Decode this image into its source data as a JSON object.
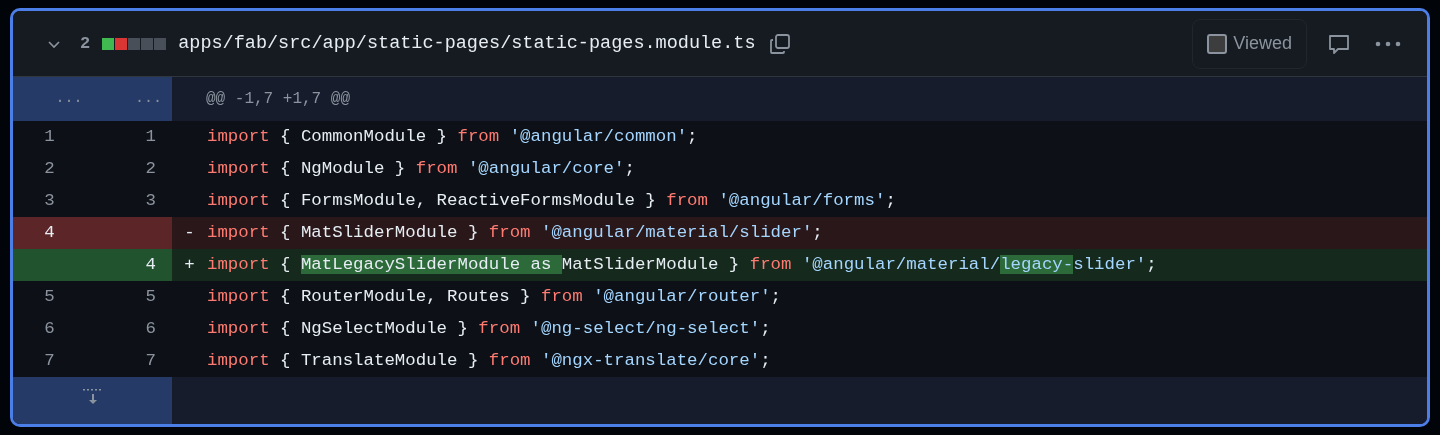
{
  "file": {
    "expanded": true,
    "change_count": "2",
    "stat_blocks": [
      {
        "color": "#3fb950"
      },
      {
        "color": "#da3633"
      },
      {
        "color": "#484f58"
      },
      {
        "color": "#484f58"
      },
      {
        "color": "#484f58"
      }
    ],
    "path": "apps/fab/src/app/static-pages/static-pages.module.ts",
    "viewed": {
      "label": "Viewed",
      "checked": false
    }
  },
  "hunk": {
    "left": "...",
    "right": "...",
    "header": "@@ -1,7 +1,7 @@"
  },
  "lines": [
    {
      "kind": "context",
      "old": "1",
      "new": "1",
      "segments": [
        {
          "kind": "keyword",
          "text": "import"
        },
        {
          "kind": "plain",
          "text": " { CommonModule } "
        },
        {
          "kind": "keyword",
          "text": "from"
        },
        {
          "kind": "string",
          "text": " '@angular/common'"
        },
        {
          "kind": "plain",
          "text": ";"
        }
      ]
    },
    {
      "kind": "context",
      "old": "2",
      "new": "2",
      "segments": [
        {
          "kind": "keyword",
          "text": "import"
        },
        {
          "kind": "plain",
          "text": " { NgModule } "
        },
        {
          "kind": "keyword",
          "text": "from"
        },
        {
          "kind": "string",
          "text": " '@angular/core'"
        },
        {
          "kind": "plain",
          "text": ";"
        }
      ]
    },
    {
      "kind": "context",
      "old": "3",
      "new": "3",
      "segments": [
        {
          "kind": "keyword",
          "text": "import"
        },
        {
          "kind": "plain",
          "text": " { FormsModule, ReactiveFormsModule } "
        },
        {
          "kind": "keyword",
          "text": "from"
        },
        {
          "kind": "string",
          "text": " '@angular/forms'"
        },
        {
          "kind": "plain",
          "text": ";"
        }
      ]
    },
    {
      "kind": "deletion",
      "old": "4",
      "sign": "-",
      "segments": [
        {
          "kind": "keyword",
          "text": "import"
        },
        {
          "kind": "plain",
          "text": " { MatSliderModule } "
        },
        {
          "kind": "keyword",
          "text": "from"
        },
        {
          "kind": "string",
          "text": " '@angular/material/slider'"
        },
        {
          "kind": "plain",
          "text": ";"
        }
      ]
    },
    {
      "kind": "addition",
      "new": "4",
      "sign": "+",
      "segments": [
        {
          "kind": "keyword",
          "text": "import"
        },
        {
          "kind": "plain",
          "text": " { "
        },
        {
          "kind": "plain",
          "text": "MatLegacySliderModule as ",
          "highlight": true
        },
        {
          "kind": "plain",
          "text": "MatSliderModule } "
        },
        {
          "kind": "keyword",
          "text": "from"
        },
        {
          "kind": "string",
          "text": " '@angular/material/"
        },
        {
          "kind": "string",
          "text": "legacy-",
          "highlight": true
        },
        {
          "kind": "string",
          "text": "slider'"
        },
        {
          "kind": "plain",
          "text": ";"
        }
      ]
    },
    {
      "kind": "context",
      "old": "5",
      "new": "5",
      "segments": [
        {
          "kind": "keyword",
          "text": "import"
        },
        {
          "kind": "plain",
          "text": " { RouterModule, Routes } "
        },
        {
          "kind": "keyword",
          "text": "from"
        },
        {
          "kind": "string",
          "text": " '@angular/router'"
        },
        {
          "kind": "plain",
          "text": ";"
        }
      ]
    },
    {
      "kind": "context",
      "old": "6",
      "new": "6",
      "segments": [
        {
          "kind": "keyword",
          "text": "import"
        },
        {
          "kind": "plain",
          "text": " { NgSelectModule } "
        },
        {
          "kind": "keyword",
          "text": "from"
        },
        {
          "kind": "string",
          "text": " '@ng-select/ng-select'"
        },
        {
          "kind": "plain",
          "text": ";"
        }
      ]
    },
    {
      "kind": "context",
      "old": "7",
      "new": "7",
      "segments": [
        {
          "kind": "keyword",
          "text": "import"
        },
        {
          "kind": "plain",
          "text": " { TranslateModule } "
        },
        {
          "kind": "keyword",
          "text": "from"
        },
        {
          "kind": "string",
          "text": " '@ngx-translate/core'"
        },
        {
          "kind": "plain",
          "text": ";"
        }
      ]
    }
  ]
}
